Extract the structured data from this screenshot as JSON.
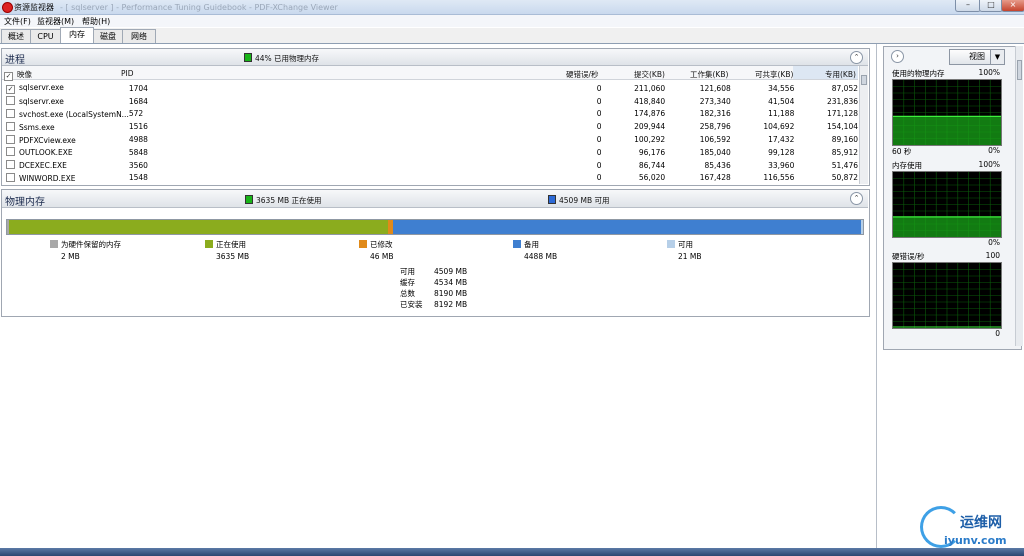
{
  "window": {
    "title": "资源监视器",
    "title_blurred": "- [ sqlserver ] - Performance Tuning Guidebook - PDF-XChange Viewer",
    "min": "–",
    "max": "□",
    "close": "×"
  },
  "menu": [
    "文件(F)",
    "监视器(M)",
    "帮助(H)"
  ],
  "tabs": [
    "概述",
    "CPU",
    "内存",
    "磁盘",
    "网络"
  ],
  "active_tab": "内存",
  "processes": {
    "title": "进程",
    "summary": "44% 已用物理内存",
    "summary_color": "#18b418",
    "columns": [
      "映像",
      "PID",
      "硬错误/秒",
      "提交(KB)",
      "工作集(KB)",
      "可共享(KB)",
      "专用(KB)"
    ],
    "rows": [
      {
        "checked": true,
        "image": "sqlservr.exe",
        "pid": "1704",
        "hard": "0",
        "commit": "211,060",
        "ws": "121,608",
        "share": "34,556",
        "priv": "87,052"
      },
      {
        "checked": false,
        "image": "sqlservr.exe",
        "pid": "1684",
        "hard": "0",
        "commit": "418,840",
        "ws": "273,340",
        "share": "41,504",
        "priv": "231,836"
      },
      {
        "checked": false,
        "image": "svchost.exe (LocalSystemN...",
        "pid": "572",
        "hard": "0",
        "commit": "174,876",
        "ws": "182,316",
        "share": "11,188",
        "priv": "171,128"
      },
      {
        "checked": false,
        "image": "Ssms.exe",
        "pid": "1516",
        "hard": "0",
        "commit": "209,944",
        "ws": "258,796",
        "share": "104,692",
        "priv": "154,104"
      },
      {
        "checked": false,
        "image": "PDFXCview.exe",
        "pid": "4988",
        "hard": "0",
        "commit": "100,292",
        "ws": "106,592",
        "share": "17,432",
        "priv": "89,160"
      },
      {
        "checked": false,
        "image": "OUTLOOK.EXE",
        "pid": "5848",
        "hard": "0",
        "commit": "96,176",
        "ws": "185,040",
        "share": "99,128",
        "priv": "85,912"
      },
      {
        "checked": false,
        "image": "DCEXEC.EXE",
        "pid": "3560",
        "hard": "0",
        "commit": "86,744",
        "ws": "85,436",
        "share": "33,960",
        "priv": "51,476"
      },
      {
        "checked": false,
        "image": "WINWORD.EXE",
        "pid": "1548",
        "hard": "0",
        "commit": "56,020",
        "ws": "167,428",
        "share": "116,556",
        "priv": "50,872"
      }
    ]
  },
  "physical": {
    "title": "物理内存",
    "in_use_summary": "3635 MB 正在使用",
    "available_summary": "4509 MB 可用",
    "bar": [
      {
        "key": "reserved",
        "mb": 2,
        "color": "#a8a8a8"
      },
      {
        "key": "in_use",
        "mb": 3635,
        "color": "#8bac1e"
      },
      {
        "key": "modified",
        "mb": 46,
        "color": "#e08a1a"
      },
      {
        "key": "standby",
        "mb": 4488,
        "color": "#3f7fd0"
      },
      {
        "key": "free",
        "mb": 21,
        "color": "#b6cfe8"
      }
    ],
    "legend": [
      {
        "label": "为硬件保留的内存",
        "value": "2 MB",
        "color": "#a8a8a8"
      },
      {
        "label": "正在使用",
        "value": "3635 MB",
        "color": "#8bac1e"
      },
      {
        "label": "已修改",
        "value": "46 MB",
        "color": "#e08a1a"
      },
      {
        "label": "备用",
        "value": "4488 MB",
        "color": "#3f7fd0"
      },
      {
        "label": "可用",
        "value": "21 MB",
        "color": "#b6cfe8"
      }
    ],
    "stats": [
      {
        "label": "可用",
        "value": "4509 MB"
      },
      {
        "label": "缓存",
        "value": "4534 MB"
      },
      {
        "label": "总数",
        "value": "8190 MB"
      },
      {
        "label": "已安装",
        "value": "8192 MB"
      }
    ]
  },
  "right": {
    "view_label": "视图",
    "graphs": [
      {
        "title": "使用的物理内存",
        "top": "100%",
        "time": "60 秒",
        "bottom": "0%",
        "level": 0.44
      },
      {
        "title": "内存使用",
        "top": "100%",
        "bottom": "0%",
        "level": 0.31
      },
      {
        "title": "硬错误/秒",
        "top": "100",
        "bottom": "0",
        "level": 0.0
      }
    ]
  },
  "watermark": {
    "brand": "运维网",
    "url": "iyunv.com"
  }
}
